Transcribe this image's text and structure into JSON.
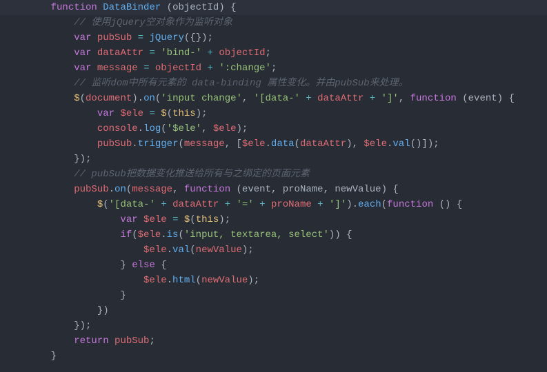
{
  "code": {
    "lines": [
      {
        "indent": 1,
        "highlight": true,
        "tokens": [
          {
            "t": "kw",
            "v": "function"
          },
          {
            "t": "sp",
            "v": " "
          },
          {
            "t": "fn",
            "v": "DataBinder"
          },
          {
            "t": "sp",
            "v": " "
          },
          {
            "t": "paren",
            "v": "("
          },
          {
            "t": "param",
            "v": "objectId"
          },
          {
            "t": "paren",
            "v": ")"
          },
          {
            "t": "sp",
            "v": " "
          },
          {
            "t": "brace",
            "v": "{"
          }
        ]
      },
      {
        "indent": 2,
        "tokens": [
          {
            "t": "comment",
            "v": "// 使用jQuery空对象作为监听对象"
          }
        ]
      },
      {
        "indent": 2,
        "tokens": [
          {
            "t": "kw",
            "v": "var"
          },
          {
            "t": "sp",
            "v": " "
          },
          {
            "t": "var",
            "v": "pubSub"
          },
          {
            "t": "sp",
            "v": " "
          },
          {
            "t": "op",
            "v": "="
          },
          {
            "t": "sp",
            "v": " "
          },
          {
            "t": "fn",
            "v": "jQuery"
          },
          {
            "t": "paren",
            "v": "("
          },
          {
            "t": "brace",
            "v": "{}"
          },
          {
            "t": "paren",
            "v": ")"
          },
          {
            "t": "punct",
            "v": ";"
          }
        ]
      },
      {
        "indent": 2,
        "tokens": [
          {
            "t": "kw",
            "v": "var"
          },
          {
            "t": "sp",
            "v": " "
          },
          {
            "t": "var",
            "v": "dataAttr"
          },
          {
            "t": "sp",
            "v": " "
          },
          {
            "t": "op",
            "v": "="
          },
          {
            "t": "sp",
            "v": " "
          },
          {
            "t": "str",
            "v": "'bind-'"
          },
          {
            "t": "sp",
            "v": " "
          },
          {
            "t": "op",
            "v": "+"
          },
          {
            "t": "sp",
            "v": " "
          },
          {
            "t": "var",
            "v": "objectId"
          },
          {
            "t": "punct",
            "v": ";"
          }
        ]
      },
      {
        "indent": 2,
        "tokens": [
          {
            "t": "kw",
            "v": "var"
          },
          {
            "t": "sp",
            "v": " "
          },
          {
            "t": "var",
            "v": "message"
          },
          {
            "t": "sp",
            "v": " "
          },
          {
            "t": "op",
            "v": "="
          },
          {
            "t": "sp",
            "v": " "
          },
          {
            "t": "var",
            "v": "objectId"
          },
          {
            "t": "sp",
            "v": " "
          },
          {
            "t": "op",
            "v": "+"
          },
          {
            "t": "sp",
            "v": " "
          },
          {
            "t": "str",
            "v": "':change'"
          },
          {
            "t": "punct",
            "v": ";"
          }
        ]
      },
      {
        "indent": 2,
        "tokens": [
          {
            "t": "comment",
            "v": "// 监听dom中所有元素的 data-binding 属性变化。并由pubSub来处理。"
          }
        ]
      },
      {
        "indent": 2,
        "tokens": [
          {
            "t": "dollar",
            "v": "$"
          },
          {
            "t": "paren",
            "v": "("
          },
          {
            "t": "prop",
            "v": "document"
          },
          {
            "t": "paren",
            "v": ")"
          },
          {
            "t": "punct",
            "v": "."
          },
          {
            "t": "method",
            "v": "on"
          },
          {
            "t": "paren",
            "v": "("
          },
          {
            "t": "str",
            "v": "'input change'"
          },
          {
            "t": "punct",
            "v": ","
          },
          {
            "t": "sp",
            "v": " "
          },
          {
            "t": "str",
            "v": "'[data-'"
          },
          {
            "t": "sp",
            "v": " "
          },
          {
            "t": "op",
            "v": "+"
          },
          {
            "t": "sp",
            "v": " "
          },
          {
            "t": "var",
            "v": "dataAttr"
          },
          {
            "t": "sp",
            "v": " "
          },
          {
            "t": "op",
            "v": "+"
          },
          {
            "t": "sp",
            "v": " "
          },
          {
            "t": "str",
            "v": "']'"
          },
          {
            "t": "punct",
            "v": ","
          },
          {
            "t": "sp",
            "v": " "
          },
          {
            "t": "kw",
            "v": "function"
          },
          {
            "t": "sp",
            "v": " "
          },
          {
            "t": "paren",
            "v": "("
          },
          {
            "t": "param",
            "v": "event"
          },
          {
            "t": "paren",
            "v": ")"
          },
          {
            "t": "sp",
            "v": " "
          },
          {
            "t": "brace",
            "v": "{"
          }
        ]
      },
      {
        "indent": 3,
        "tokens": [
          {
            "t": "kw",
            "v": "var"
          },
          {
            "t": "sp",
            "v": " "
          },
          {
            "t": "var",
            "v": "$ele"
          },
          {
            "t": "sp",
            "v": " "
          },
          {
            "t": "op",
            "v": "="
          },
          {
            "t": "sp",
            "v": " "
          },
          {
            "t": "dollar",
            "v": "$"
          },
          {
            "t": "paren",
            "v": "("
          },
          {
            "t": "this",
            "v": "this"
          },
          {
            "t": "paren",
            "v": ")"
          },
          {
            "t": "punct",
            "v": ";"
          }
        ]
      },
      {
        "indent": 3,
        "tokens": [
          {
            "t": "prop",
            "v": "console"
          },
          {
            "t": "punct",
            "v": "."
          },
          {
            "t": "method",
            "v": "log"
          },
          {
            "t": "paren",
            "v": "("
          },
          {
            "t": "str",
            "v": "'$ele'"
          },
          {
            "t": "punct",
            "v": ","
          },
          {
            "t": "sp",
            "v": " "
          },
          {
            "t": "var",
            "v": "$ele"
          },
          {
            "t": "paren",
            "v": ")"
          },
          {
            "t": "punct",
            "v": ";"
          }
        ]
      },
      {
        "indent": 3,
        "tokens": [
          {
            "t": "var",
            "v": "pubSub"
          },
          {
            "t": "punct",
            "v": "."
          },
          {
            "t": "method",
            "v": "trigger"
          },
          {
            "t": "paren",
            "v": "("
          },
          {
            "t": "var",
            "v": "message"
          },
          {
            "t": "punct",
            "v": ","
          },
          {
            "t": "sp",
            "v": " "
          },
          {
            "t": "bracket",
            "v": "["
          },
          {
            "t": "var",
            "v": "$ele"
          },
          {
            "t": "punct",
            "v": "."
          },
          {
            "t": "method",
            "v": "data"
          },
          {
            "t": "paren",
            "v": "("
          },
          {
            "t": "var",
            "v": "dataAttr"
          },
          {
            "t": "paren",
            "v": ")"
          },
          {
            "t": "punct",
            "v": ","
          },
          {
            "t": "sp",
            "v": " "
          },
          {
            "t": "var",
            "v": "$ele"
          },
          {
            "t": "punct",
            "v": "."
          },
          {
            "t": "method",
            "v": "val"
          },
          {
            "t": "paren",
            "v": "()"
          },
          {
            "t": "bracket",
            "v": "]"
          },
          {
            "t": "paren",
            "v": ")"
          },
          {
            "t": "punct",
            "v": ";"
          }
        ]
      },
      {
        "indent": 2,
        "tokens": [
          {
            "t": "brace",
            "v": "}"
          },
          {
            "t": "paren",
            "v": ")"
          },
          {
            "t": "punct",
            "v": ";"
          }
        ]
      },
      {
        "indent": 2,
        "tokens": [
          {
            "t": "comment",
            "v": "// pubSub把数据变化推送给所有与之绑定的页面元素"
          }
        ]
      },
      {
        "indent": 2,
        "tokens": [
          {
            "t": "var",
            "v": "pubSub"
          },
          {
            "t": "punct",
            "v": "."
          },
          {
            "t": "method",
            "v": "on"
          },
          {
            "t": "paren",
            "v": "("
          },
          {
            "t": "var",
            "v": "message"
          },
          {
            "t": "punct",
            "v": ","
          },
          {
            "t": "sp",
            "v": " "
          },
          {
            "t": "kw",
            "v": "function"
          },
          {
            "t": "sp",
            "v": " "
          },
          {
            "t": "paren",
            "v": "("
          },
          {
            "t": "param",
            "v": "event"
          },
          {
            "t": "punct",
            "v": ","
          },
          {
            "t": "sp",
            "v": " "
          },
          {
            "t": "param",
            "v": "proName"
          },
          {
            "t": "punct",
            "v": ","
          },
          {
            "t": "sp",
            "v": " "
          },
          {
            "t": "param",
            "v": "newValue"
          },
          {
            "t": "paren",
            "v": ")"
          },
          {
            "t": "sp",
            "v": " "
          },
          {
            "t": "brace",
            "v": "{"
          }
        ]
      },
      {
        "indent": 3,
        "tokens": [
          {
            "t": "dollar",
            "v": "$"
          },
          {
            "t": "paren",
            "v": "("
          },
          {
            "t": "str",
            "v": "'[data-'"
          },
          {
            "t": "sp",
            "v": " "
          },
          {
            "t": "op",
            "v": "+"
          },
          {
            "t": "sp",
            "v": " "
          },
          {
            "t": "var",
            "v": "dataAttr"
          },
          {
            "t": "sp",
            "v": " "
          },
          {
            "t": "op",
            "v": "+"
          },
          {
            "t": "sp",
            "v": " "
          },
          {
            "t": "str",
            "v": "'='"
          },
          {
            "t": "sp",
            "v": " "
          },
          {
            "t": "op",
            "v": "+"
          },
          {
            "t": "sp",
            "v": " "
          },
          {
            "t": "var",
            "v": "proName"
          },
          {
            "t": "sp",
            "v": " "
          },
          {
            "t": "op",
            "v": "+"
          },
          {
            "t": "sp",
            "v": " "
          },
          {
            "t": "str",
            "v": "']'"
          },
          {
            "t": "paren",
            "v": ")"
          },
          {
            "t": "punct",
            "v": "."
          },
          {
            "t": "method",
            "v": "each"
          },
          {
            "t": "paren",
            "v": "("
          },
          {
            "t": "kw",
            "v": "function"
          },
          {
            "t": "sp",
            "v": " "
          },
          {
            "t": "paren",
            "v": "()"
          },
          {
            "t": "sp",
            "v": " "
          },
          {
            "t": "brace",
            "v": "{"
          }
        ]
      },
      {
        "indent": 4,
        "tokens": [
          {
            "t": "kw",
            "v": "var"
          },
          {
            "t": "sp",
            "v": " "
          },
          {
            "t": "var",
            "v": "$ele"
          },
          {
            "t": "sp",
            "v": " "
          },
          {
            "t": "op",
            "v": "="
          },
          {
            "t": "sp",
            "v": " "
          },
          {
            "t": "dollar",
            "v": "$"
          },
          {
            "t": "paren",
            "v": "("
          },
          {
            "t": "this",
            "v": "this"
          },
          {
            "t": "paren",
            "v": ")"
          },
          {
            "t": "punct",
            "v": ";"
          }
        ]
      },
      {
        "indent": 4,
        "tokens": [
          {
            "t": "kw",
            "v": "if"
          },
          {
            "t": "paren",
            "v": "("
          },
          {
            "t": "var",
            "v": "$ele"
          },
          {
            "t": "punct",
            "v": "."
          },
          {
            "t": "method",
            "v": "is"
          },
          {
            "t": "paren",
            "v": "("
          },
          {
            "t": "str",
            "v": "'input, textarea, select'"
          },
          {
            "t": "paren",
            "v": "))"
          },
          {
            "t": "sp",
            "v": " "
          },
          {
            "t": "brace",
            "v": "{"
          }
        ]
      },
      {
        "indent": 5,
        "tokens": [
          {
            "t": "var",
            "v": "$ele"
          },
          {
            "t": "punct",
            "v": "."
          },
          {
            "t": "method",
            "v": "val"
          },
          {
            "t": "paren",
            "v": "("
          },
          {
            "t": "var",
            "v": "newValue"
          },
          {
            "t": "paren",
            "v": ")"
          },
          {
            "t": "punct",
            "v": ";"
          }
        ]
      },
      {
        "indent": 4,
        "tokens": [
          {
            "t": "brace",
            "v": "}"
          },
          {
            "t": "sp",
            "v": " "
          },
          {
            "t": "kw",
            "v": "else"
          },
          {
            "t": "sp",
            "v": " "
          },
          {
            "t": "brace",
            "v": "{"
          }
        ]
      },
      {
        "indent": 5,
        "tokens": [
          {
            "t": "var",
            "v": "$ele"
          },
          {
            "t": "punct",
            "v": "."
          },
          {
            "t": "method",
            "v": "html"
          },
          {
            "t": "paren",
            "v": "("
          },
          {
            "t": "var",
            "v": "newValue"
          },
          {
            "t": "paren",
            "v": ")"
          },
          {
            "t": "punct",
            "v": ";"
          }
        ]
      },
      {
        "indent": 4,
        "tokens": [
          {
            "t": "brace",
            "v": "}"
          }
        ]
      },
      {
        "indent": 3,
        "tokens": [
          {
            "t": "brace",
            "v": "}"
          },
          {
            "t": "paren",
            "v": ")"
          }
        ]
      },
      {
        "indent": 2,
        "tokens": [
          {
            "t": "brace",
            "v": "}"
          },
          {
            "t": "paren",
            "v": ")"
          },
          {
            "t": "punct",
            "v": ";"
          }
        ]
      },
      {
        "indent": 2,
        "tokens": [
          {
            "t": "kw",
            "v": "return"
          },
          {
            "t": "sp",
            "v": " "
          },
          {
            "t": "var",
            "v": "pubSub"
          },
          {
            "t": "punct",
            "v": ";"
          }
        ]
      },
      {
        "indent": 1,
        "tokens": [
          {
            "t": "brace",
            "v": "}"
          }
        ]
      }
    ]
  }
}
